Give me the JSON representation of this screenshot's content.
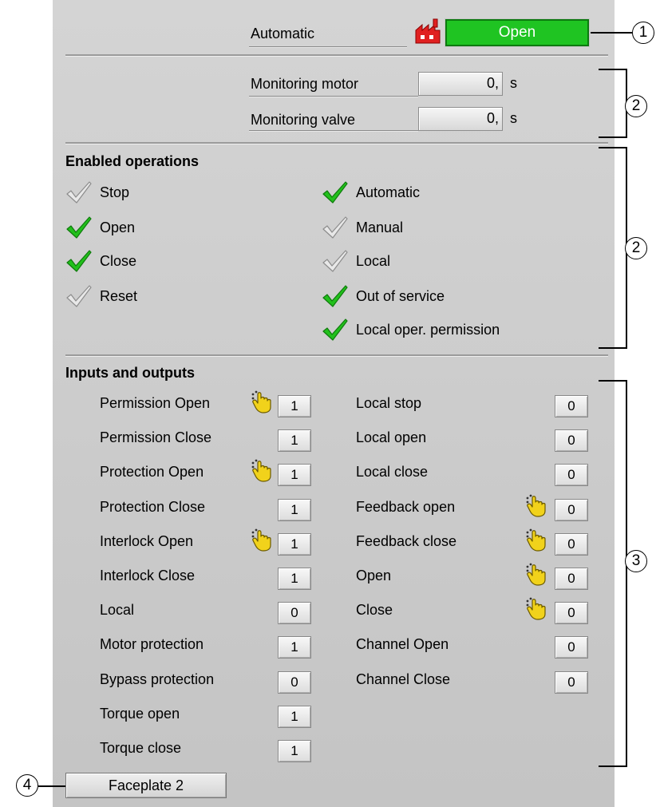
{
  "status": {
    "mode_label": "Automatic",
    "state_button": "Open",
    "state_color": "#1fc422"
  },
  "monitoring": [
    {
      "label": "Monitoring motor",
      "value": "0,",
      "unit": "s"
    },
    {
      "label": "Monitoring valve",
      "value": "0,",
      "unit": "s"
    }
  ],
  "enabled_operations": {
    "title": "Enabled operations",
    "left": [
      {
        "label": "Stop",
        "enabled": false
      },
      {
        "label": "Open",
        "enabled": true
      },
      {
        "label": "Close",
        "enabled": true
      },
      {
        "label": "Reset",
        "enabled": false
      }
    ],
    "right": [
      {
        "label": "Automatic",
        "enabled": true
      },
      {
        "label": "Manual",
        "enabled": false
      },
      {
        "label": "Local",
        "enabled": false
      },
      {
        "label": "Out of service",
        "enabled": true
      },
      {
        "label": "Local oper. permission",
        "enabled": true
      }
    ]
  },
  "io": {
    "title": "Inputs and outputs",
    "left": [
      {
        "label": "Permission Open",
        "value": "1",
        "simulated": true
      },
      {
        "label": "Permission Close",
        "value": "1",
        "simulated": false
      },
      {
        "label": "Protection Open",
        "value": "1",
        "simulated": true
      },
      {
        "label": "Protection Close",
        "value": "1",
        "simulated": false
      },
      {
        "label": "Interlock Open",
        "value": "1",
        "simulated": true
      },
      {
        "label": "Interlock Close",
        "value": "1",
        "simulated": false
      },
      {
        "label": "Local",
        "value": "0",
        "simulated": false
      },
      {
        "label": "Motor protection",
        "value": "1",
        "simulated": false
      },
      {
        "label": "Bypass protection",
        "value": "0",
        "simulated": false
      },
      {
        "label": "Torque open",
        "value": "1",
        "simulated": false
      },
      {
        "label": "Torque close",
        "value": "1",
        "simulated": false
      }
    ],
    "right": [
      {
        "label": "Local stop",
        "value": "0",
        "simulated": false
      },
      {
        "label": "Local open",
        "value": "0",
        "simulated": false
      },
      {
        "label": "Local close",
        "value": "0",
        "simulated": false
      },
      {
        "label": "Feedback open",
        "value": "0",
        "simulated": true
      },
      {
        "label": "Feedback close",
        "value": "0",
        "simulated": true
      },
      {
        "label": "Open",
        "value": "0",
        "simulated": true
      },
      {
        "label": "Close",
        "value": "0",
        "simulated": true
      },
      {
        "label": "Channel Open",
        "value": "0",
        "simulated": false
      },
      {
        "label": "Channel Close",
        "value": "0",
        "simulated": false
      }
    ]
  },
  "faceplate_button": "Faceplate 2",
  "callouts": [
    "1",
    "2",
    "2",
    "3",
    "4"
  ],
  "icons": {
    "check_enabled": "check-green-icon",
    "check_disabled": "check-gray-icon",
    "simulation": "simulation-hand-icon",
    "mode": "automatic-factory-icon"
  }
}
